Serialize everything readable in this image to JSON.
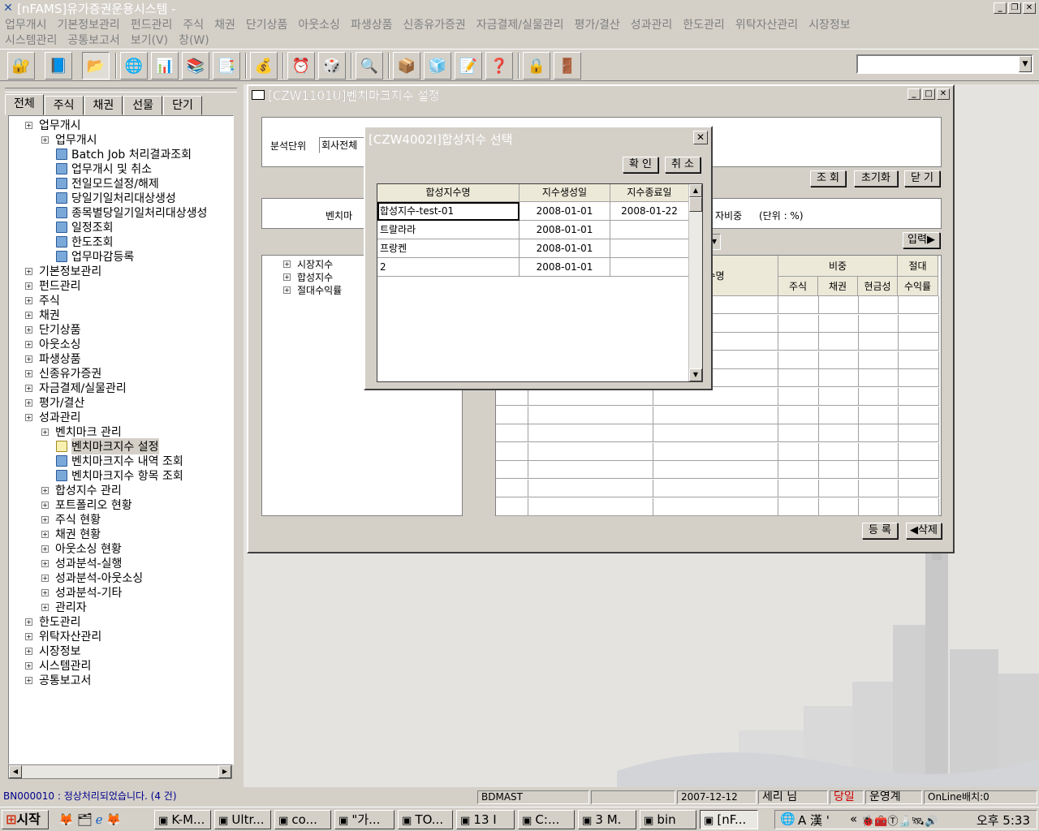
{
  "titlebar": {
    "title": "[nFAMS]유가증권운용시스템 -"
  },
  "menubar": {
    "row1": [
      "업무개시",
      "기본정보관리",
      "펀드관리",
      "주식",
      "채권",
      "단기상품",
      "아웃소싱",
      "파생상품",
      "신종유가증권",
      "자금결제/실물관리",
      "평가/결산",
      "성과관리",
      "한도관리",
      "위탁자산관리",
      "시장정보"
    ],
    "row2": [
      "시스템관리",
      "공통보고서",
      "보기(V)",
      "창(W)"
    ]
  },
  "toolbar": {
    "icons": [
      "user-lock-icon",
      "book-icon",
      "open-icon",
      "globe-icon",
      "chart-icon",
      "stack-icon",
      "clock-doc-icon",
      "coins-icon",
      "alarm-icon",
      "dice-icon",
      "search-icon",
      "box-icon",
      "cube-icon",
      "edit-icon",
      "help-icon",
      "lock-icon",
      "exit-icon"
    ]
  },
  "left_tabs": [
    "전체",
    "주식",
    "채권",
    "선물",
    "단기"
  ],
  "tree": [
    {
      "label": "업무개시",
      "type": "folder"
    },
    {
      "label": "업무개시",
      "type": "folder"
    },
    {
      "label": "Batch Job 처리결과조회",
      "type": "page"
    },
    {
      "label": "업무개시 및 취소",
      "type": "page"
    },
    {
      "label": "전일모드설정/해제",
      "type": "page"
    },
    {
      "label": "당일기일처리대상생성",
      "type": "page"
    },
    {
      "label": "종목별당일기일처리대상생성",
      "type": "page"
    },
    {
      "label": "일정조회",
      "type": "page"
    },
    {
      "label": "한도조회",
      "type": "page"
    },
    {
      "label": "업무마감등록",
      "type": "page"
    },
    {
      "label": "기본정보관리",
      "type": "folder"
    },
    {
      "label": "펀드관리",
      "type": "folder"
    },
    {
      "label": "주식",
      "type": "folder"
    },
    {
      "label": "채권",
      "type": "folder"
    },
    {
      "label": "단기상품",
      "type": "folder"
    },
    {
      "label": "아웃소싱",
      "type": "folder"
    },
    {
      "label": "파생상품",
      "type": "folder"
    },
    {
      "label": "신종유가증권",
      "type": "folder"
    },
    {
      "label": "자금결제/실물관리",
      "type": "folder"
    },
    {
      "label": "평가/결산",
      "type": "folder"
    },
    {
      "label": "성과관리",
      "type": "folder"
    },
    {
      "label": "벤치마크 관리",
      "type": "folder"
    },
    {
      "label": "벤치마크지수 설정",
      "type": "page"
    },
    {
      "label": "벤치마크지수 내역 조회",
      "type": "page"
    },
    {
      "label": "벤치마크지수 항목 조회",
      "type": "page"
    },
    {
      "label": "합성지수 관리",
      "type": "folder"
    },
    {
      "label": "포트폴리오 현황",
      "type": "folder"
    },
    {
      "label": "주식 현황",
      "type": "folder"
    },
    {
      "label": "채권 현황",
      "type": "folder"
    },
    {
      "label": "아웃소싱 현황",
      "type": "folder"
    },
    {
      "label": "성과분석-실행",
      "type": "folder"
    },
    {
      "label": "성과분석-아웃소싱",
      "type": "folder"
    },
    {
      "label": "성과분석-기타",
      "type": "folder"
    },
    {
      "label": "관리자",
      "type": "folder"
    },
    {
      "label": "한도관리",
      "type": "folder"
    },
    {
      "label": "위탁자산관리",
      "type": "folder"
    },
    {
      "label": "시장정보",
      "type": "folder"
    },
    {
      "label": "시스템관리",
      "type": "folder"
    },
    {
      "label": "공통보고서",
      "type": "folder"
    }
  ],
  "main_window": {
    "title": "[CZW1101U]벤치마크지수 설정",
    "analysis_unit_label": "분석단위",
    "analysis_unit_value": "회사전체",
    "buttons": {
      "query": "조 회",
      "reset": "초기화",
      "close": "닫 기",
      "input": "입력▶",
      "register": "등 록",
      "delete": "◀삭제"
    },
    "benchmark_label": "벤치마",
    "weight_label": "자비중",
    "unit_label": "(단위 : %)",
    "subtree": [
      "시장지수",
      "합성지수",
      "절대수익률"
    ],
    "grid_headers": {
      "name": "수명",
      "weight": "비중",
      "absolute": "절대",
      "stock": "주식",
      "bond": "채권",
      "cash": "현금성",
      "return": "수익률"
    }
  },
  "dialog": {
    "title": "[CZW4002I]합성지수 선택",
    "ok": "확 인",
    "cancel": "취 소",
    "headers": [
      "합성지수명",
      "지수생성일",
      "지수종료일"
    ],
    "rows": [
      {
        "name": "합성지수-test-01",
        "created": "2008-01-01",
        "ended": "2008-01-22"
      },
      {
        "name": "트랄라라",
        "created": "2008-01-01",
        "ended": ""
      },
      {
        "name": "프랑켄",
        "created": "2008-01-01",
        "ended": ""
      },
      {
        "name": "2",
        "created": "2008-01-01",
        "ended": ""
      }
    ]
  },
  "statusbar": {
    "message": "BN000010 : 정상처리되었습니다. (4 건)",
    "server": "BDMAST",
    "date": "2007-12-12",
    "user": "세리 님",
    "mode": "당일",
    "role": "운영계",
    "batch": "OnLine배치:0",
    "mode_color": "#d00000"
  },
  "taskbar": {
    "start": "시작",
    "tasks": [
      "K-M...",
      "Ultr...",
      "co...",
      "\"가...",
      "TO...",
      "13 I",
      "C:...",
      "3 M.",
      "bin",
      "[nF..."
    ],
    "tray_ime": "A 漢 '",
    "clock": "오후 5:33"
  }
}
